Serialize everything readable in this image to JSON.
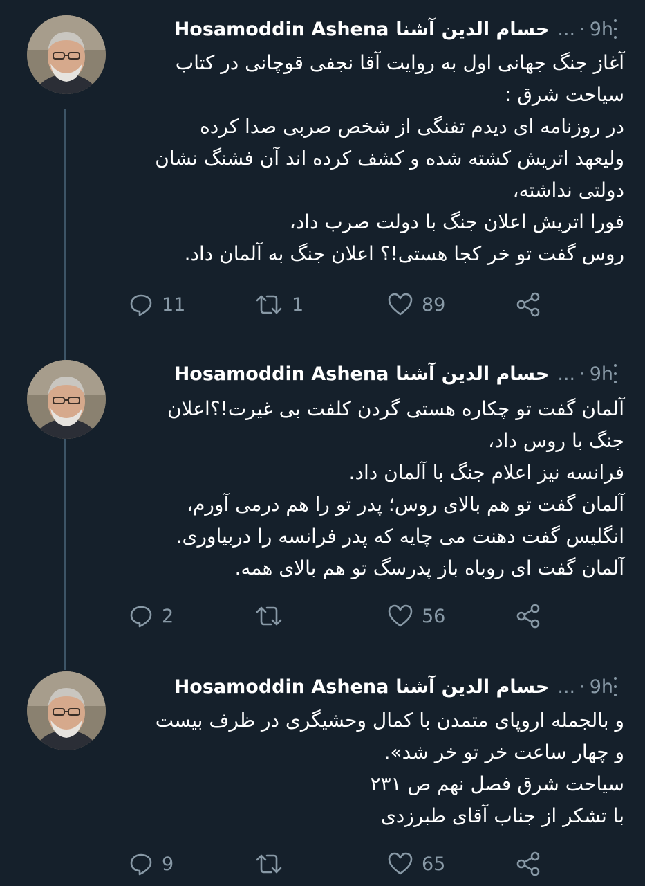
{
  "user": {
    "name": "Hosamoddin Ashena",
    "name_fa": "حسام الدین آشنا",
    "more": "...",
    "dot": "·",
    "time": "9h"
  },
  "tweets": [
    {
      "text": "آغاز جنگ جهانی اول به روایت آقا نجفی قوچانی در کتاب\nسیاحت شرق :\nدر روزنامه ای دیدم تفنگی از شخص صربی صدا کرده\nولیعهد اتریش کشته شده و کشف کرده اند آن فشنگ نشان\nدولتی نداشته،\nفورا اتریش اعلان جنگ با دولت صرب داد،\nروس گفت تو خر کجا هستی!؟ اعلان جنگ به آلمان داد.",
      "replies": "11",
      "retweets": "1",
      "likes": "89"
    },
    {
      "text": "آلمان گفت تو چکاره هستی گردن کلفت بی غیرت!؟اعلان\nجنگ با روس داد،\nفرانسه نیز اعلام جنگ با آلمان داد.\nآلمان گفت تو هم بالای روس؛ پدر تو را هم درمی آورم،\nانگلیس گفت دهنت می چایه که پدر فرانسه را دربیاوری.\nآلمان گفت ای روباه باز پدرسگ تو هم بالای همه.",
      "replies": "2",
      "retweets": "",
      "likes": "56"
    },
    {
      "text": "و بالجمله اروپای متمدن با کمال وحشیگری در ظرف بیست\nو چهار ساعت خر تو خر شد».\nسیاحت شرق فصل نهم ص ۲۳۱\nبا تشکر از جناب آقای طبرزدی",
      "replies": "9",
      "retweets": "",
      "likes": "65"
    }
  ]
}
